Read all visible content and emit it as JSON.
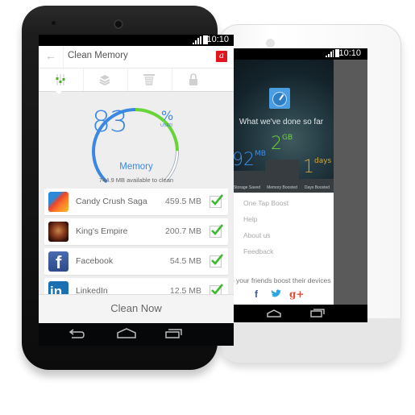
{
  "back_phone": {
    "status": {
      "time": "10:10"
    },
    "hero_title": "What we've done so far",
    "stats": {
      "memory": {
        "value": "2",
        "unit": "GB",
        "label": "Memory Boosted",
        "color": "#6cd23c"
      },
      "storage": {
        "value": "92",
        "unit": "MB",
        "label": "Storage Saved",
        "color": "#3c8ee8"
      },
      "days": {
        "value": "1",
        "unit": "days",
        "label": "Days Boosted",
        "color": "#d7a82c"
      }
    },
    "menu": [
      {
        "label": "One Tap Boost",
        "icon": "boost-icon"
      },
      {
        "label": "Help",
        "icon": "help-icon"
      },
      {
        "label": "About us",
        "icon": "info-icon"
      },
      {
        "label": "Feedback",
        "icon": "feedback-icon"
      }
    ],
    "share_text": "lp your friends boost their devices",
    "social": [
      {
        "label": "f",
        "icon": "facebook-icon",
        "color": "#3b5998"
      },
      {
        "label": "🐦",
        "icon": "twitter-icon",
        "color": "#2aa9e0"
      },
      {
        "label": "g+",
        "icon": "google-plus-icon",
        "color": "#dd4b39"
      }
    ]
  },
  "front_phone": {
    "status": {
      "time": "10:10"
    },
    "app_bar": {
      "title": "Clean Memory",
      "brand_glyph": "a"
    },
    "tabs": [
      {
        "name": "memory-tab",
        "icon": "equalizer-icon",
        "active": true
      },
      {
        "name": "storage-tab",
        "icon": "layers-icon",
        "active": false
      },
      {
        "name": "trash-tab",
        "icon": "trash-icon",
        "active": false
      },
      {
        "name": "privacy-tab",
        "icon": "lock-icon",
        "active": false
      }
    ],
    "gauge": {
      "value": "83",
      "percent_used": 83,
      "percent_symbol": "%",
      "used_label": "USED",
      "label": "Memory",
      "subtitle": "744.9 MB available to clean",
      "colors": {
        "used_blue": "#3b88e2",
        "used_green": "#67d43a",
        "free": "#9aa6b4"
      }
    },
    "apps": [
      {
        "name": "Candy Crush Saga",
        "size": "459.5 MB",
        "checked": true
      },
      {
        "name": "King's Empire",
        "size": "200.7 MB",
        "checked": true
      },
      {
        "name": "Facebook",
        "size": "54.5 MB",
        "checked": true
      },
      {
        "name": "LinkedIn",
        "size": "12.5 MB",
        "checked": true
      }
    ],
    "clean_button": "Clean Now"
  }
}
